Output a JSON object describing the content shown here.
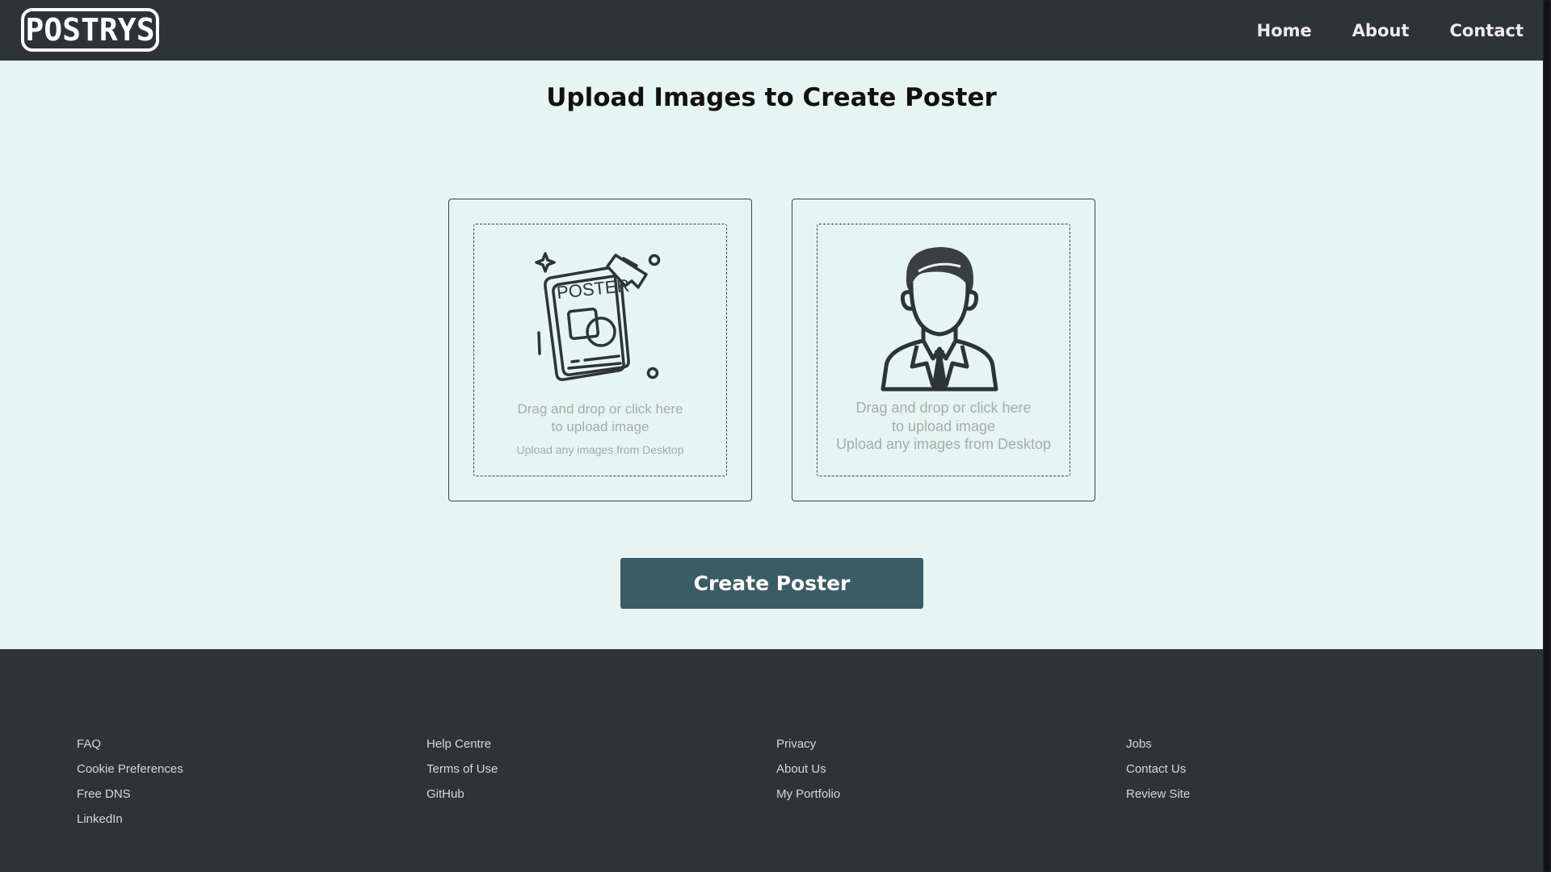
{
  "header": {
    "logo_text": "POSTRYS",
    "nav": [
      {
        "label": "Home"
      },
      {
        "label": "About"
      },
      {
        "label": "Contact"
      }
    ]
  },
  "main": {
    "title": "Upload Images to Create Poster",
    "upload_cards": [
      {
        "illustration_icon": "poster-icon",
        "illustration_text": "POSTER",
        "instruction_line1": "Drag and drop or click here",
        "instruction_line2": "to upload image",
        "sub_text": "Upload any images from Desktop"
      },
      {
        "illustration_icon": "person-avatar-icon",
        "instruction_line1": "Drag and drop or click here",
        "instruction_line2": "to upload image",
        "sub_text": "Upload any images from Desktop"
      }
    ],
    "create_button_label": "Create Poster"
  },
  "footer": {
    "columns": [
      {
        "links": [
          "FAQ",
          "Cookie Preferences",
          "Free DNS",
          "LinkedIn"
        ]
      },
      {
        "links": [
          "Help Centre",
          "Terms of Use",
          "GitHub"
        ]
      },
      {
        "links": [
          "Privacy",
          "About Us",
          "My Portfolio"
        ]
      },
      {
        "links": [
          "Jobs",
          "Contact Us",
          "Review Site"
        ]
      }
    ]
  },
  "colors": {
    "header_bg": "#2d3436",
    "main_bg": "#e6f5f1",
    "button_bg": "#3a5c65",
    "footer_bg": "#2d3436"
  }
}
